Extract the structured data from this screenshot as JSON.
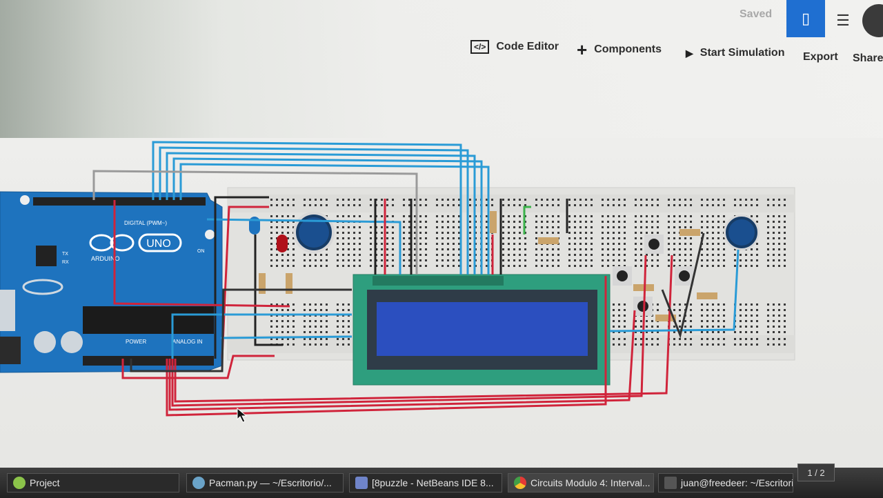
{
  "toolbar": {
    "saved": "Saved",
    "code_editor": "Code Editor",
    "components": "Components",
    "start_simulation": "Start Simulation",
    "export": "Export",
    "share": "Share"
  },
  "board": {
    "brand": "ARDUINO",
    "model": "UNO",
    "digital_label": "DIGITAL (PWM~)",
    "power_label": "POWER",
    "analog_label": "ANALOG IN",
    "on_label": "ON",
    "tx_label": "TX",
    "rx_label": "RX"
  },
  "taskbar": {
    "items": [
      {
        "label": "Project"
      },
      {
        "label": "Pacman.py — ~/Escritorio/..."
      },
      {
        "label": "[8puzzle - NetBeans IDE 8..."
      },
      {
        "label": "Circuits Modulo 4: Interval..."
      },
      {
        "label": "juan@freedeer: ~/Escritori..."
      }
    ],
    "pager": "1 / 2"
  },
  "colors": {
    "accent": "#1f6fd1",
    "arduino_blue": "#1e73be",
    "lcd_green": "#2e9e7e",
    "wire_red": "#d0243b",
    "wire_blue": "#2a9bd6",
    "wire_black": "#222222",
    "wire_gray": "#9a9a9a"
  }
}
